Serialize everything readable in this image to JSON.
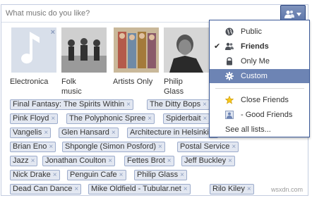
{
  "question": "What music do you like?",
  "tiles": [
    {
      "label": "Electronica",
      "icon": "music-note-icon"
    },
    {
      "label": "Folk music",
      "icon": "photo"
    },
    {
      "label": "Artists Only",
      "icon": "photo"
    },
    {
      "label": "Philip Glass",
      "icon": "photo"
    }
  ],
  "tags": [
    "Final Fantasy: The Spirits Within",
    "The Ditty Bops",
    "Pink Floyd",
    "The Polyphonic Spree",
    "Spiderbait",
    "Vangelis",
    "Glen Hansard",
    "Architecture in Helsinki",
    "Brian Eno",
    "Shpongle (Simon Posford)",
    "Postal Service",
    "Jazz",
    "Jonathan Coulton",
    "Fettes Brot",
    "Jeff Buckley",
    "Nick Drake",
    "Penguin Cafe",
    "Philip Glass",
    "Dead Can Dance",
    "Mike Oldfield - Tubular.net",
    "Rilo Kiley"
  ],
  "tag_remove_glyph": "×",
  "privacy_menu": {
    "items": [
      {
        "label": "Public",
        "icon": "globe-icon",
        "checked": false
      },
      {
        "label": "Friends",
        "icon": "friends-icon",
        "checked": true
      },
      {
        "label": "Only Me",
        "icon": "lock-icon",
        "checked": false
      },
      {
        "label": "Custom",
        "icon": "gear-icon",
        "checked": false,
        "selected": true
      },
      {
        "label": "Close Friends",
        "icon": "star-icon",
        "checked": false
      },
      {
        "label": "- Good Friends",
        "icon": "friend-list-icon",
        "checked": false
      },
      {
        "label": "See all lists...",
        "icon": "",
        "checked": false
      }
    ],
    "check_glyph": "✔"
  },
  "watermark": "wsxdn.com",
  "colors": {
    "accent": "#3b5998",
    "selected": "#6d84b4",
    "tag_bg": "#e2e7f1"
  }
}
